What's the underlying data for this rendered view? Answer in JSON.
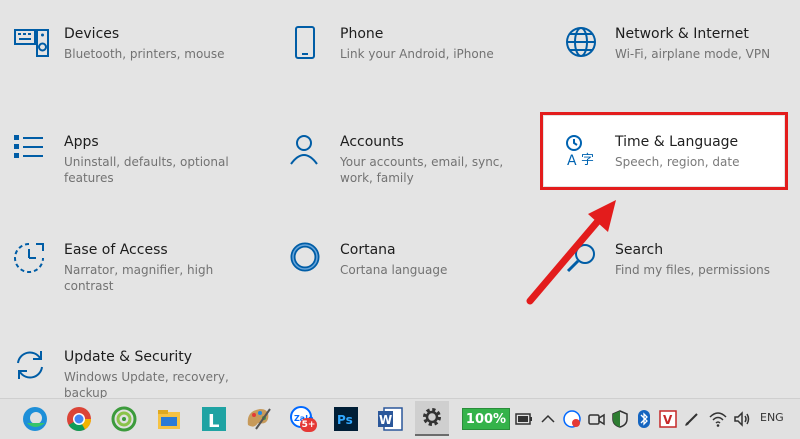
{
  "tiles": [
    {
      "title": "Devices",
      "desc": "Bluetooth, printers, mouse",
      "icon": "keyboard-speaker-icon"
    },
    {
      "title": "Phone",
      "desc": "Link your Android, iPhone",
      "icon": "phone-icon"
    },
    {
      "title": "Network & Internet",
      "desc": "Wi-Fi, airplane mode, VPN",
      "icon": "globe-icon"
    },
    {
      "title": "Apps",
      "desc": "Uninstall, defaults, optional features",
      "icon": "apps-list-icon"
    },
    {
      "title": "Accounts",
      "desc": "Your accounts, email, sync, work, family",
      "icon": "person-icon"
    },
    {
      "title": "Time & Language",
      "desc": "Speech, region, date",
      "icon": "time-language-icon"
    },
    {
      "title": "Ease of Access",
      "desc": "Narrator, magnifier, high contrast",
      "icon": "ease-of-access-icon"
    },
    {
      "title": "Cortana",
      "desc": "Cortana language",
      "icon": "cortana-ring-icon"
    },
    {
      "title": "Search",
      "desc": "Find my files, permissions",
      "icon": "search-icon"
    },
    {
      "title": "Update & Security",
      "desc": "Windows Update, recovery, backup",
      "icon": "update-arrows-icon"
    }
  ],
  "taskbar": {
    "battery_label": "100%",
    "notification_badge": "5+",
    "language": "ENG"
  },
  "colors": {
    "accent": "#0063b1",
    "highlight": "#e31c1c"
  }
}
